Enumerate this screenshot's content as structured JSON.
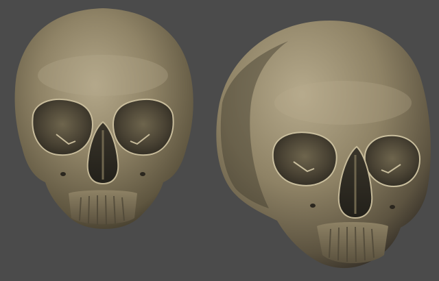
{
  "scene": {
    "background_color": "#4b4b4b",
    "material_color": "#8f8366",
    "models": [
      {
        "name": "skull-front-view"
      },
      {
        "name": "skull-three-quarter-view"
      }
    ]
  }
}
